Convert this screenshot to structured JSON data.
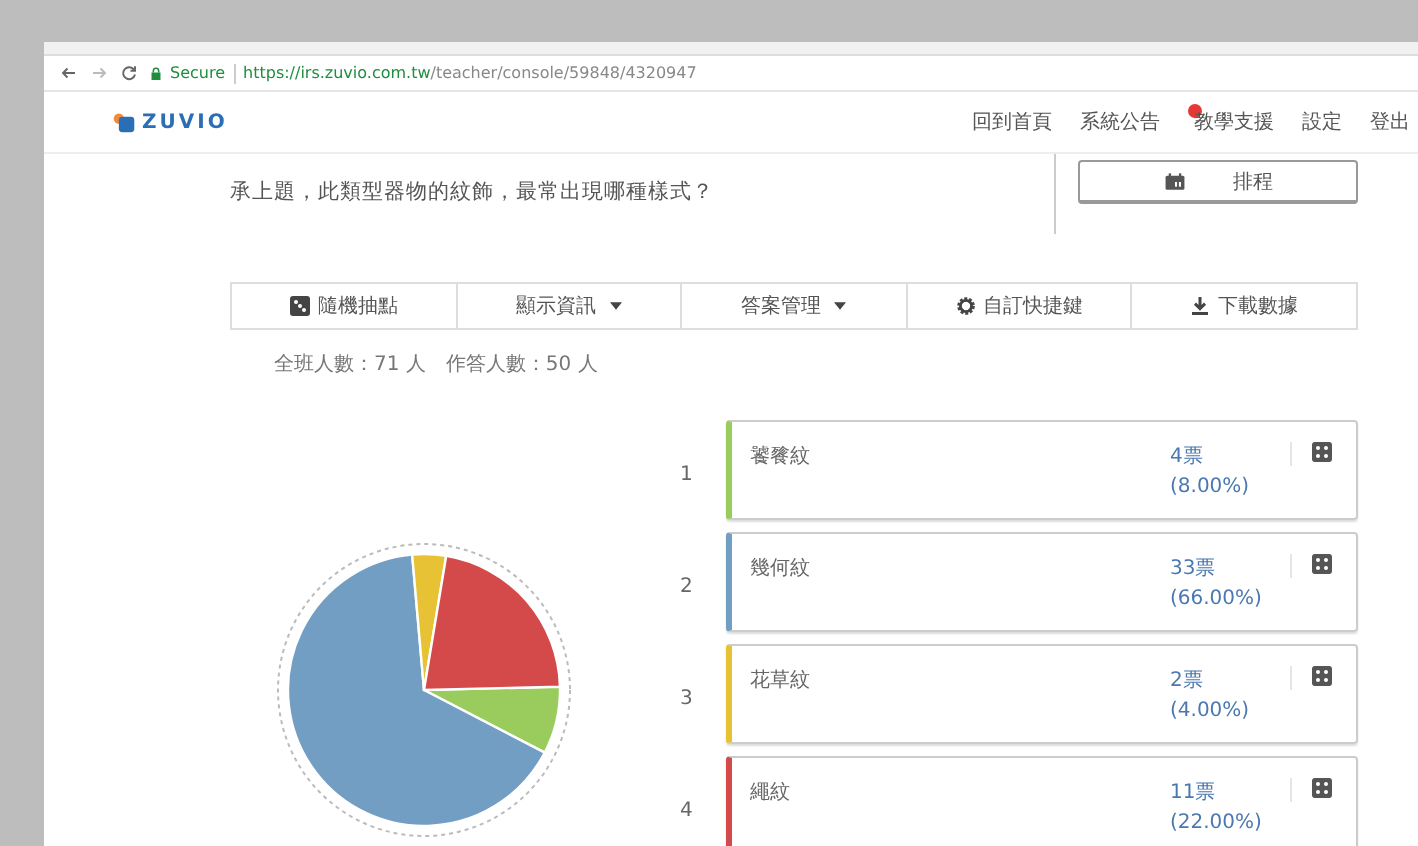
{
  "browser": {
    "secure_label": "Secure",
    "url_host": "https://irs.zuvio.com.tw",
    "url_path": "/teacher/console/59848/4320947"
  },
  "nav": {
    "logo": "ZUVIO",
    "items": [
      {
        "label": "回到首頁",
        "badge": false
      },
      {
        "label": "系統公告",
        "badge": false
      },
      {
        "label": "教學支援",
        "badge": true
      },
      {
        "label": "設定",
        "badge": false
      },
      {
        "label": "登出",
        "badge": false
      }
    ]
  },
  "question": "承上題，此類型器物的紋飾，最常出現哪種樣式？",
  "schedule_button": "排程",
  "toolbar": [
    {
      "kind": "random",
      "label": "隨機抽點"
    },
    {
      "kind": "dropdown",
      "label": "顯示資訊"
    },
    {
      "kind": "dropdown",
      "label": "答案管理"
    },
    {
      "kind": "settings",
      "label": "自訂快捷鍵"
    },
    {
      "kind": "download",
      "label": "下載數據"
    }
  ],
  "stats": [
    "全班人數：71 人",
    "作答人數：50 人"
  ],
  "chart_data": {
    "type": "pie",
    "categories": [
      "饕餮紋",
      "幾何紋",
      "花草紋",
      "繩紋"
    ],
    "values": [
      8,
      66,
      4,
      22
    ]
  },
  "options": [
    {
      "number": "1",
      "votes": "4票",
      "percent": "(8.00%)",
      "color": "#99cc5c"
    },
    {
      "number": "2",
      "votes": "33票",
      "percent": "(66.00%)",
      "color": "#739ec4"
    },
    {
      "number": "3",
      "votes": "2票",
      "percent": "(4.00%)",
      "color": "#e6c234"
    },
    {
      "number": "4",
      "votes": "11票",
      "percent": "(22.00%)",
      "color": "#d44a4a"
    }
  ]
}
